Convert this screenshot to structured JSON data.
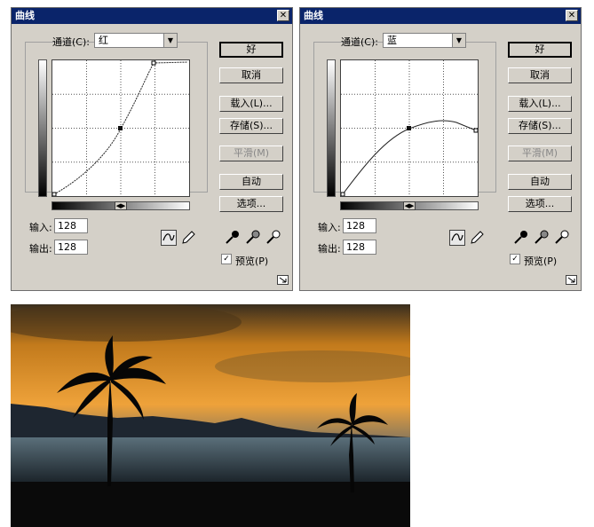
{
  "dialogs": [
    {
      "title": "曲线",
      "channel_label": "通道(C):",
      "channel_value": "红",
      "input_label": "输入:",
      "input_value": "128",
      "output_label": "输出:",
      "output_value": "128",
      "buttons": {
        "ok": "好",
        "cancel": "取消",
        "load": "载入(L)...",
        "save": "存储(S)...",
        "smooth": "平滑(M)",
        "auto": "自动",
        "options": "选项..."
      },
      "preview_label": "预览(P)",
      "preview_checked": true
    },
    {
      "title": "曲线",
      "channel_label": "通道(C):",
      "channel_value": "蓝",
      "input_label": "输入:",
      "input_value": "128",
      "output_label": "输出:",
      "output_value": "128",
      "buttons": {
        "ok": "好",
        "cancel": "取消",
        "load": "载入(L)...",
        "save": "存储(S)...",
        "smooth": "平滑(M)",
        "auto": "自动",
        "options": "选项..."
      },
      "preview_label": "预览(P)",
      "preview_checked": true
    }
  ],
  "icons": [
    "close-icon",
    "chevron-down-icon",
    "curve-tool-icon",
    "pencil-tool-icon",
    "black-eyedropper-icon",
    "gray-eyedropper-icon",
    "white-eyedropper-icon",
    "resize-icon"
  ],
  "photo": {
    "subject": "sunset-palm-trees",
    "sky_color": "#e8a030"
  }
}
